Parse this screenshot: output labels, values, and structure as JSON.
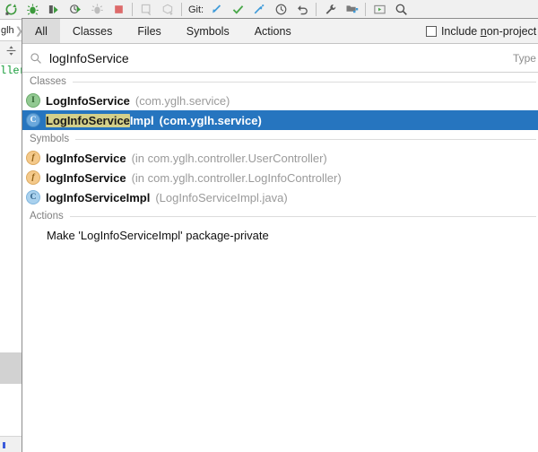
{
  "toolbar": {
    "icons": [
      {
        "name": "rerun-icon",
        "glyph": "⟳"
      },
      {
        "name": "debug-icon",
        "glyph": "🐞"
      },
      {
        "name": "run-with-coverage-icon",
        "glyph": "▶"
      },
      {
        "name": "profile-icon",
        "glyph": "◴"
      },
      {
        "name": "attach-debugger-icon",
        "glyph": "🐛"
      },
      {
        "name": "stop-icon",
        "glyph": "■"
      },
      {
        "name": "build-project-icon",
        "glyph": "⌷"
      },
      {
        "name": "build-module-icon",
        "glyph": "⎔"
      },
      {
        "name": "update-project-icon",
        "glyph": "↙"
      },
      {
        "name": "commit-icon",
        "glyph": "✓"
      },
      {
        "name": "push-icon",
        "glyph": "↱"
      },
      {
        "name": "history-icon",
        "glyph": "◷"
      },
      {
        "name": "rollback-icon",
        "glyph": "↺"
      },
      {
        "name": "settings-icon",
        "glyph": "🔧"
      },
      {
        "name": "project-structure-icon",
        "glyph": "▦"
      },
      {
        "name": "select-in-icon",
        "glyph": "⊡"
      },
      {
        "name": "search-everywhere-icon",
        "glyph": "⌕"
      }
    ],
    "git_label": "Git:"
  },
  "background": {
    "breadcrumb_text": "glh",
    "breadcrumb_separator": "❯",
    "gutter_icon": "collapse-all-icon",
    "editor_fragment": "ller"
  },
  "search_everywhere": {
    "tabs": [
      {
        "label": "All",
        "selected": true
      },
      {
        "label": "Classes",
        "selected": false
      },
      {
        "label": "Files",
        "selected": false
      },
      {
        "label": "Symbols",
        "selected": false
      },
      {
        "label": "Actions",
        "selected": false
      }
    ],
    "non_project": {
      "checked": false,
      "label_before": "Include ",
      "label_mnemonic": "n",
      "label_after": "on-project it"
    },
    "search": {
      "value": "logInfoService",
      "placeholder": "Type / to see commands",
      "hint": "Type / to"
    },
    "sections": [
      {
        "title": "Classes",
        "rows": [
          {
            "icon": "interface-icon",
            "icon_letter": "I",
            "icon_kind": "iface",
            "name_prefix": "",
            "name_highlight": "",
            "name": "LogInfoService",
            "location": "(com.yglh.service)",
            "selected": false
          },
          {
            "icon": "class-icon",
            "icon_letter": "C",
            "icon_kind": "cls",
            "name_highlight": "LogInfoService",
            "name_suffix": "Impl",
            "location": "(com.yglh.service)",
            "selected": true
          }
        ]
      },
      {
        "title": "Symbols",
        "rows": [
          {
            "icon": "field-icon",
            "icon_letter": "f",
            "icon_kind": "field",
            "name": "logInfoService",
            "location": "(in com.yglh.controller.UserController)",
            "selected": false
          },
          {
            "icon": "field-icon",
            "icon_letter": "f",
            "icon_kind": "field",
            "name": "logInfoService",
            "location": "(in com.yglh.controller.LogInfoController)",
            "selected": false
          },
          {
            "icon": "class-icon",
            "icon_letter": "C",
            "icon_kind": "cls-light",
            "name": "logInfoServiceImpl",
            "location": "(LogInfoServiceImpl.java)",
            "selected": false
          }
        ]
      },
      {
        "title": "Actions",
        "rows": [
          {
            "action_text": "Make 'LogInfoServiceImpl' package-private",
            "is_action": true,
            "selected": false
          }
        ]
      }
    ]
  },
  "colors": {
    "selection_blue": "#2675bf",
    "match_highlight": "#d4d08a",
    "toolbar_bg": "#f0f0f0",
    "tab_selected_bg": "#dcdcdc",
    "muted_text": "#9a9a9a"
  }
}
